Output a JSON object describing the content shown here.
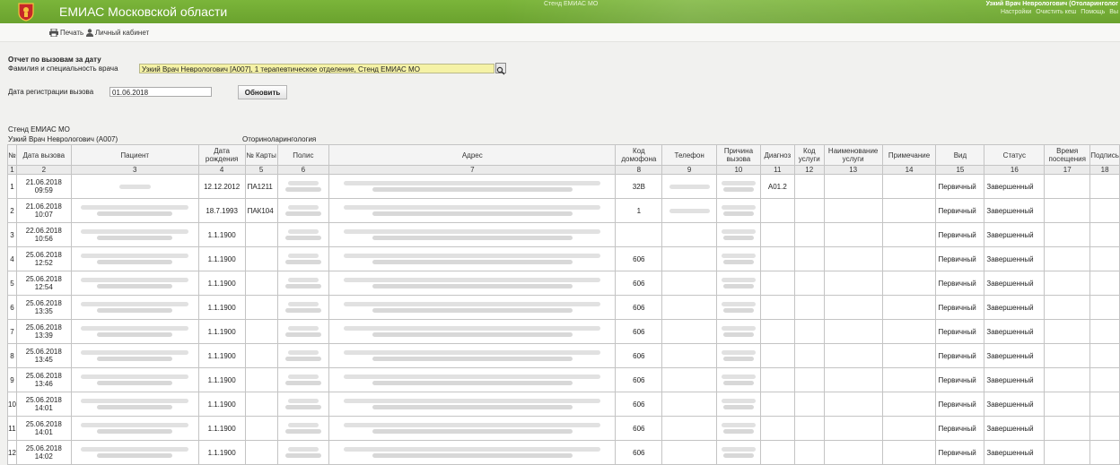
{
  "header": {
    "title": "ЕМИАС Московской области",
    "stand": "Стенд ЕМИАС МО",
    "user": "Узкий Врач Неврологович (Отоларинголог",
    "menu": [
      "Настройки",
      "Очистить кеш",
      "Помощь",
      "Вы"
    ]
  },
  "toolbar": {
    "print": "Печать",
    "cabinet": "Личный кабинет"
  },
  "form": {
    "report_title": "Отчет по вызовам за дату",
    "doctor_label": "Фамилия и специальность врача",
    "doctor_value": "Узкий Врач Неврологович [А007], 1 терапевтическое отделение, Стенд ЕМИАС МО",
    "date_label": "Дата регистрации вызова",
    "date_value": "01.06.2018",
    "refresh_button": "Обновить"
  },
  "report": {
    "org": "Стенд ЕМИАС МО",
    "doctor": "Узкий Врач Неврологович (А007)",
    "specialty": "Оториноларингология"
  },
  "table": {
    "headers": [
      "№",
      "Дата вызова",
      "Пациент",
      "Дата рождения",
      "№ Карты",
      "Полис",
      "Адрес",
      "Код домофона",
      "Телефон",
      "Причина вызова",
      "Диагноз",
      "Код услуги",
      "Наименование услуги",
      "Примечание",
      "Вид",
      "Статус",
      "Время посещения",
      "Подпись"
    ],
    "numbers": [
      "1",
      "2",
      "3",
      "4",
      "5",
      "6",
      "7",
      "8",
      "9",
      "10",
      "11",
      "12",
      "13",
      "14",
      "15",
      "16",
      "17",
      "18"
    ],
    "rows": [
      {
        "n": "1",
        "date": "21.06.2018",
        "time": "09:59",
        "birth": "12.12.2012",
        "card": "ПА1211",
        "intercom": "32В",
        "diag": "А01.2",
        "kind": "Первичный",
        "status": "Завершенный"
      },
      {
        "n": "2",
        "date": "21.06.2018",
        "time": "10:07",
        "birth": "18.7.1993",
        "card": "ПАК104",
        "intercom": "1",
        "diag": "",
        "kind": "Первичный",
        "status": "Завершенный"
      },
      {
        "n": "3",
        "date": "22.06.2018",
        "time": "10:56",
        "birth": "1.1.1900",
        "card": "",
        "intercom": "",
        "diag": "",
        "kind": "Первичный",
        "status": "Завершенный"
      },
      {
        "n": "4",
        "date": "25.06.2018",
        "time": "12:52",
        "birth": "1.1.1900",
        "card": "",
        "intercom": "606",
        "diag": "",
        "kind": "Первичный",
        "status": "Завершенный"
      },
      {
        "n": "5",
        "date": "25.06.2018",
        "time": "12:54",
        "birth": "1.1.1900",
        "card": "",
        "intercom": "606",
        "diag": "",
        "kind": "Первичный",
        "status": "Завершенный"
      },
      {
        "n": "6",
        "date": "25.06.2018",
        "time": "13:35",
        "birth": "1.1.1900",
        "card": "",
        "intercom": "606",
        "diag": "",
        "kind": "Первичный",
        "status": "Завершенный"
      },
      {
        "n": "7",
        "date": "25.06.2018",
        "time": "13:39",
        "birth": "1.1.1900",
        "card": "",
        "intercom": "606",
        "diag": "",
        "kind": "Первичный",
        "status": "Завершенный"
      },
      {
        "n": "8",
        "date": "25.06.2018",
        "time": "13:45",
        "birth": "1.1.1900",
        "card": "",
        "intercom": "606",
        "diag": "",
        "kind": "Первичный",
        "status": "Завершенный"
      },
      {
        "n": "9",
        "date": "25.06.2018",
        "time": "13:46",
        "birth": "1.1.1900",
        "card": "",
        "intercom": "606",
        "diag": "",
        "kind": "Первичный",
        "status": "Завершенный"
      },
      {
        "n": "10",
        "date": "25.06.2018",
        "time": "14:01",
        "birth": "1.1.1900",
        "card": "",
        "intercom": "606",
        "diag": "",
        "kind": "Первичный",
        "status": "Завершенный"
      },
      {
        "n": "11",
        "date": "25.06.2018",
        "time": "14:01",
        "birth": "1.1.1900",
        "card": "",
        "intercom": "606",
        "diag": "",
        "kind": "Первичный",
        "status": "Завершенный"
      },
      {
        "n": "12",
        "date": "25.06.2018",
        "time": "14:02",
        "birth": "1.1.1900",
        "card": "",
        "intercom": "606",
        "diag": "",
        "kind": "Первичный",
        "status": "Завершенный"
      }
    ]
  },
  "colors": {
    "brand": "#6aa22e",
    "field": "#f5f2a6"
  }
}
